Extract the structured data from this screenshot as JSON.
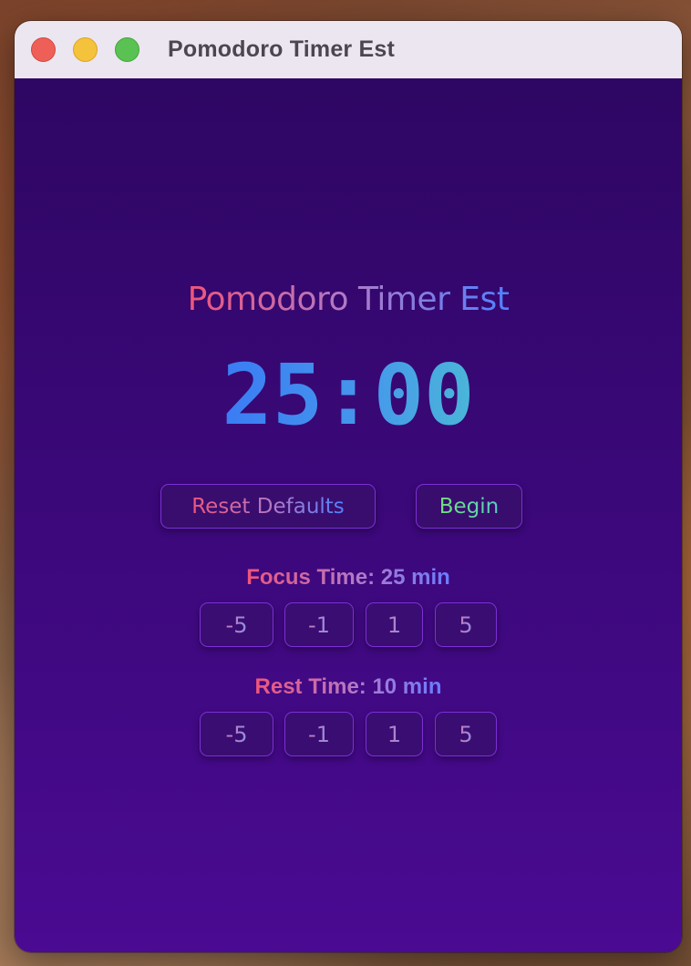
{
  "window": {
    "title": "Pomodoro Timer Est"
  },
  "app": {
    "heading": "Pomodoro Timer Est",
    "timer_display": "25:00"
  },
  "controls": {
    "reset_label": "Reset Defaults",
    "begin_label": "Begin"
  },
  "focus": {
    "label": "Focus Time: 25 min",
    "steps": [
      "-5",
      "-1",
      "1",
      "5"
    ]
  },
  "rest": {
    "label": "Rest Time: 10 min",
    "steps": [
      "-5",
      "-1",
      "1",
      "5"
    ]
  },
  "colors": {
    "background_top": "#2e0663",
    "background_bottom": "#4a0a92",
    "button_border": "#7d2fd6",
    "accent_pink": "#f0557a",
    "accent_blue": "#4f82ff",
    "timer_blue": "#3a7cf4",
    "begin_green": "#6fe07a"
  }
}
